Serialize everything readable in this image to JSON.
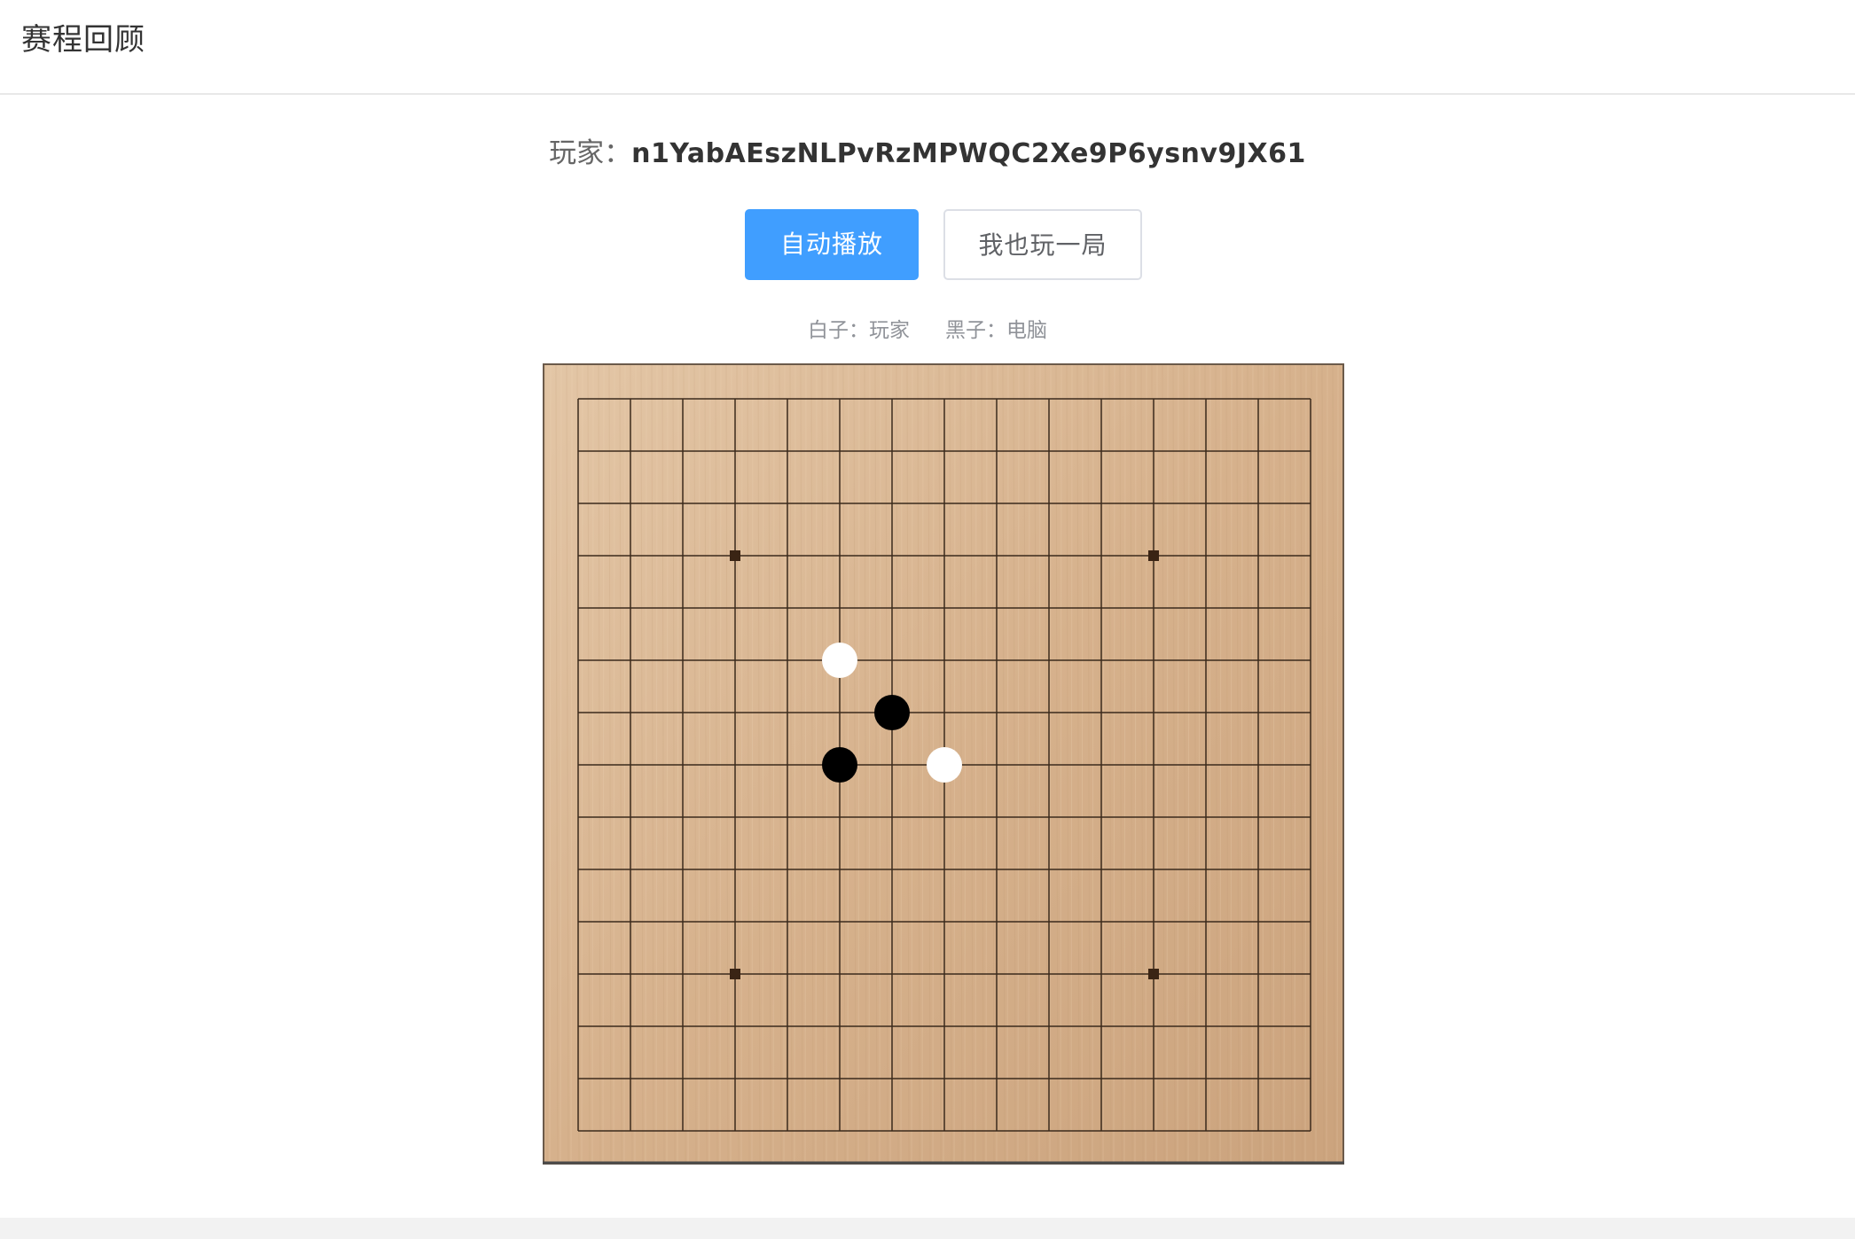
{
  "header": {
    "title": "赛程回顾"
  },
  "player": {
    "label": "玩家：",
    "id": "n1YabAEszNLPvRzMPWQC2Xe9P6ysnv9JX61"
  },
  "buttons": {
    "autoplay_label": "自动播放",
    "play_label": "我也玩一局"
  },
  "sides": {
    "white": "白子：玩家",
    "black": "黑子：电脑"
  },
  "board": {
    "size": 15,
    "star_points": [
      [
        3,
        3
      ],
      [
        11,
        3
      ],
      [
        3,
        11
      ],
      [
        11,
        11
      ]
    ],
    "stones": [
      {
        "col": 5,
        "row": 5,
        "color": "white"
      },
      {
        "col": 6,
        "row": 6,
        "color": "black"
      },
      {
        "col": 5,
        "row": 7,
        "color": "black"
      },
      {
        "col": 7,
        "row": 7,
        "color": "white"
      }
    ],
    "colors": {
      "wood_light": "#dcbb98",
      "wood_dark": "#c9a27c",
      "grid_line": "#3b2a1c",
      "frame": "#5a4a3c",
      "white_stone": "#ffffff",
      "black_stone": "#000000"
    }
  }
}
